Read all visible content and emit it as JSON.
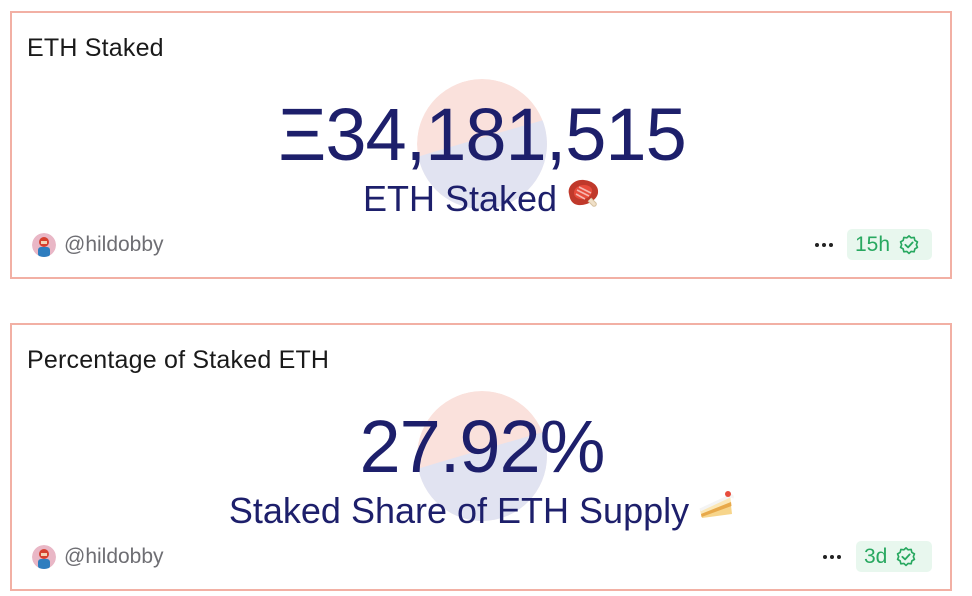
{
  "colors": {
    "card_border": "#f2b0a4",
    "value_text": "#1d1f6b",
    "title_text": "#1a1a1a",
    "author_text": "#6e6e73",
    "badge_bg": "#e8f7ee",
    "badge_text": "#28a860"
  },
  "cards": [
    {
      "title": "ETH Staked",
      "value": "Ξ34,181,515",
      "label": "ETH Staked",
      "label_emoji": "steak-emoji",
      "author": "@hildobby",
      "age": "15h",
      "age_icon": "verified-check-icon",
      "more_icon": "more-dots-icon"
    },
    {
      "title": "Percentage of Staked ETH",
      "value": "27.92%",
      "label": "Staked Share of ETH Supply",
      "label_emoji": "cake-emoji",
      "author": "@hildobby",
      "age": "3d",
      "age_icon": "verified-check-icon",
      "more_icon": "more-dots-icon"
    }
  ]
}
